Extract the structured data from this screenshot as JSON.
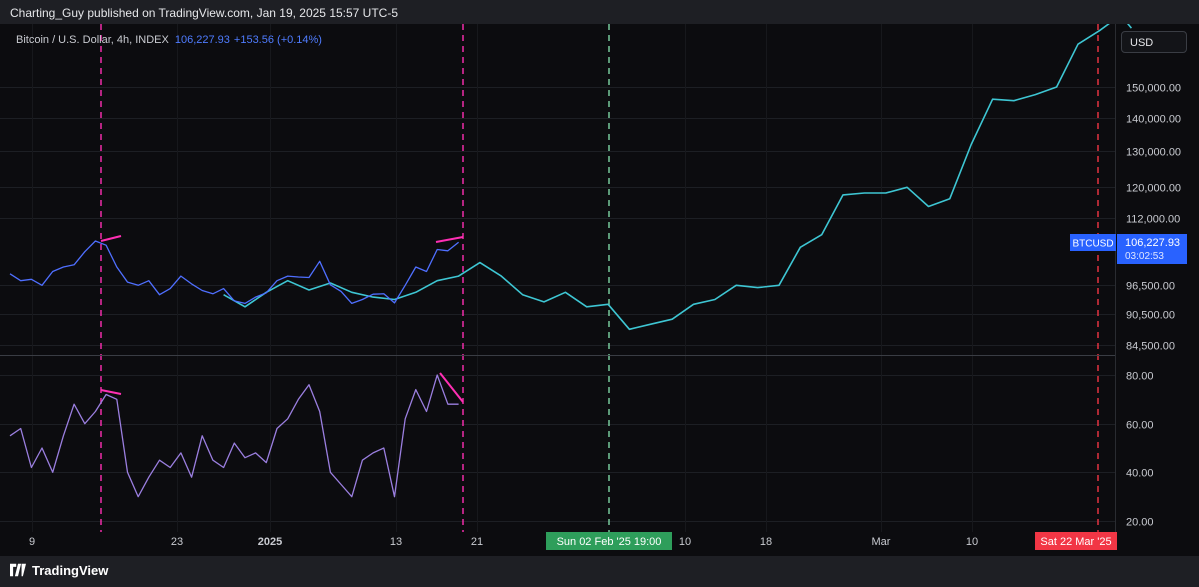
{
  "header": {
    "published": "Charting_Guy published on TradingView.com, Jan 19, 2025 15:57 UTC-5"
  },
  "symbol": {
    "name": "Bitcoin / U.S. Dollar, 4h, INDEX",
    "price": "106,227.93",
    "change": "+153.56 (+0.14%)"
  },
  "currency_button": "USD",
  "price_badge": {
    "ticker": "BTCUSD",
    "price": "106,227.93",
    "countdown": "03:02:53"
  },
  "date_badges": {
    "green": "Sun 02 Feb '25   19:00",
    "red": "Sat 22 Mar '25"
  },
  "footer": {
    "logo": "TradingView"
  },
  "colors": {
    "background": "#0c0c0f",
    "blue_series": "#4f6fff",
    "cyan_series": "#3ec6d3",
    "rsi": "#9b7fe0",
    "magenta": "#ff2fb4",
    "red": "#f23645",
    "green": "#2e9e5b",
    "price_badge": "#2962ff"
  },
  "chart_data": [
    {
      "type": "line",
      "panel": "price",
      "y_axis_ticks": [
        "150,000.00",
        "140,000.00",
        "130,000.00",
        "120,000.00",
        "112,000.00",
        "96,500.00",
        "90,500.00",
        "84,500.00"
      ],
      "x_axis_ticks": [
        "9",
        "23",
        "2025",
        "13",
        "21",
        "10",
        "18",
        "Mar",
        "10"
      ],
      "scale": "log",
      "series": [
        {
          "key": "btc",
          "x": [
            "Dec 08",
            "Dec 09",
            "Dec 10",
            "Dec 11",
            "Dec 12",
            "Dec 13",
            "Dec 14",
            "Dec 15",
            "Dec 16",
            "Dec 17",
            "Dec 18",
            "Dec 19",
            "Dec 20",
            "Dec 21",
            "Dec 22",
            "Dec 23",
            "Dec 24",
            "Dec 25",
            "Dec 26",
            "Dec 27",
            "Dec 28",
            "Dec 29",
            "Dec 30",
            "Dec 31",
            "Jan 01",
            "Jan 02",
            "Jan 03",
            "Jan 04",
            "Jan 05",
            "Jan 06",
            "Jan 07",
            "Jan 08",
            "Jan 09",
            "Jan 10",
            "Jan 11",
            "Jan 12",
            "Jan 13",
            "Jan 14",
            "Jan 15",
            "Jan 16",
            "Jan 17",
            "Jan 18",
            "Jan 19"
          ],
          "values": [
            99000,
            97500,
            97800,
            96500,
            99500,
            100500,
            101000,
            104000,
            106500,
            105500,
            100500,
            97200,
            96500,
            97500,
            94500,
            95800,
            98500,
            96800,
            95400,
            94700,
            95800,
            93200,
            92700,
            94000,
            94900,
            97500,
            98500,
            98300,
            98200,
            101800,
            96600,
            95200,
            92700,
            93500,
            94600,
            94700,
            92800,
            96500,
            100500,
            99500,
            104500,
            104200,
            106200
          ]
        },
        {
          "key": "fractal",
          "x": [
            "Dec 28",
            "Dec 30",
            "Jan 01",
            "Jan 03",
            "Jan 05",
            "Jan 07",
            "Jan 09",
            "Jan 11",
            "Jan 13",
            "Jan 15",
            "Jan 17",
            "Jan 19",
            "Jan 21",
            "Jan 23",
            "Jan 25",
            "Jan 27",
            "Jan 29",
            "Jan 31",
            "Feb 02",
            "Feb 04",
            "Feb 06",
            "Feb 08",
            "Feb 10",
            "Feb 12",
            "Feb 14",
            "Feb 16",
            "Feb 18",
            "Feb 20",
            "Feb 22",
            "Feb 24",
            "Feb 26",
            "Feb 28",
            "Mar 02",
            "Mar 04",
            "Mar 06",
            "Mar 08",
            "Mar 10",
            "Mar 12",
            "Mar 14",
            "Mar 16",
            "Mar 18",
            "Mar 20",
            "Mar 22",
            "Mar 23"
          ],
          "values": [
            94500,
            92000,
            95000,
            97500,
            95500,
            97000,
            95000,
            94000,
            93500,
            95000,
            97500,
            98500,
            101500,
            98500,
            94500,
            93000,
            95000,
            92000,
            92500,
            87500,
            88500,
            89500,
            92500,
            93500,
            96500,
            96000,
            96500,
            105000,
            108000,
            118000,
            118500,
            118500,
            120000,
            115000,
            117000,
            132000,
            146000,
            145500,
            147500,
            150000,
            165000,
            170000,
            176000,
            171000
          ]
        }
      ]
    },
    {
      "type": "line",
      "panel": "rsi",
      "y_axis_ticks": [
        "80.00",
        "60.00",
        "40.00",
        "20.00"
      ],
      "ylim": [
        16,
        86
      ],
      "series": [
        {
          "key": "rsi",
          "x": [
            "Dec 08",
            "Dec 09",
            "Dec 10",
            "Dec 11",
            "Dec 12",
            "Dec 13",
            "Dec 14",
            "Dec 15",
            "Dec 16",
            "Dec 17",
            "Dec 18",
            "Dec 19",
            "Dec 20",
            "Dec 21",
            "Dec 22",
            "Dec 23",
            "Dec 24",
            "Dec 25",
            "Dec 26",
            "Dec 27",
            "Dec 28",
            "Dec 29",
            "Dec 30",
            "Dec 31",
            "Jan 01",
            "Jan 02",
            "Jan 03",
            "Jan 04",
            "Jan 05",
            "Jan 06",
            "Jan 07",
            "Jan 08",
            "Jan 09",
            "Jan 10",
            "Jan 11",
            "Jan 12",
            "Jan 13",
            "Jan 14",
            "Jan 15",
            "Jan 16",
            "Jan 17",
            "Jan 18",
            "Jan 19"
          ],
          "values": [
            55,
            58,
            42,
            50,
            40,
            55,
            68,
            60,
            65,
            72,
            70,
            40,
            30,
            38,
            45,
            42,
            48,
            38,
            55,
            45,
            42,
            52,
            46,
            48,
            44,
            58,
            62,
            70,
            76,
            65,
            40,
            35,
            30,
            45,
            48,
            50,
            30,
            62,
            74,
            65,
            80,
            68,
            68
          ]
        }
      ]
    }
  ]
}
